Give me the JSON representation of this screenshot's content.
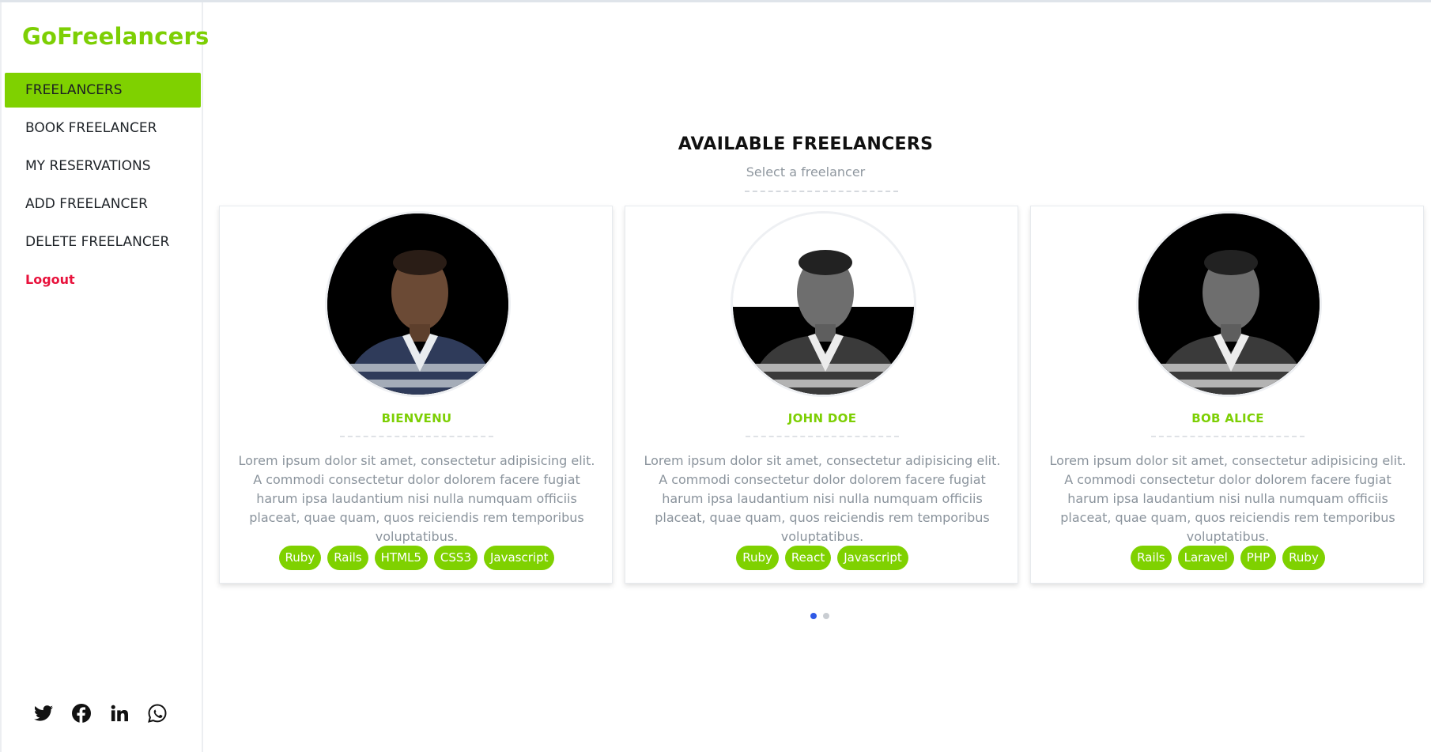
{
  "brand": "GoFreelancers",
  "nav": [
    {
      "label": "FREELANCERS"
    },
    {
      "label": "BOOK FREELANCER"
    },
    {
      "label": "MY RESERVATIONS"
    },
    {
      "label": "ADD FREELANCER"
    },
    {
      "label": "DELETE FREELANCER"
    },
    {
      "label": "Logout"
    }
  ],
  "social_icons": [
    "twitter-icon",
    "facebook-icon",
    "linkedin-icon",
    "whatsapp-icon"
  ],
  "main": {
    "title": "AVAILABLE FREELANCERS",
    "subtitle": "Select a freelancer"
  },
  "cards": [
    {
      "name": "BIENVENU",
      "description": "Lorem ipsum dolor sit amet, consectetur adipisicing elit. A commodi consectetur dolor dolorem facere fugiat harum ipsa laudantium nisi nulla numquam officiis placeat, quae quam, quos reiciendis rem temporibus voluptatibus.",
      "tags": [
        "Ruby",
        "Rails",
        "HTML5",
        "CSS3",
        "Javascript"
      ]
    },
    {
      "name": "JOHN DOE",
      "description": "Lorem ipsum dolor sit amet, consectetur adipisicing elit. A commodi consectetur dolor dolorem facere fugiat harum ipsa laudantium nisi nulla numquam officiis placeat, quae quam, quos reiciendis rem temporibus voluptatibus.",
      "tags": [
        "Ruby",
        "React",
        "Javascript"
      ]
    },
    {
      "name": "BOB ALICE",
      "description": "Lorem ipsum dolor sit amet, consectetur adipisicing elit. A commodi consectetur dolor dolorem facere fugiat harum ipsa laudantium nisi nulla numquam officiis placeat, quae quam, quos reiciendis rem temporibus voluptatibus.",
      "tags": [
        "Rails",
        "Laravel",
        "PHP",
        "Ruby"
      ]
    }
  ],
  "carousel": {
    "active_page": 1,
    "page_count": 2
  },
  "colors": {
    "accent": "#7fd100",
    "logout": "#e8123c",
    "nav_arrow": "#2e59e6"
  }
}
